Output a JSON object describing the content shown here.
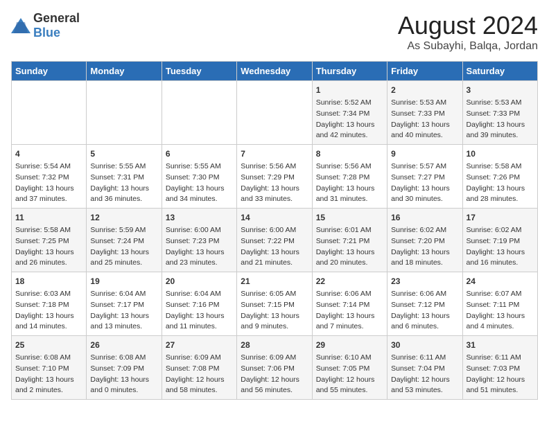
{
  "logo": {
    "general": "General",
    "blue": "Blue"
  },
  "title": "August 2024",
  "subtitle": "As Subayhi, Balqa, Jordan",
  "weekdays": [
    "Sunday",
    "Monday",
    "Tuesday",
    "Wednesday",
    "Thursday",
    "Friday",
    "Saturday"
  ],
  "weeks": [
    [
      {
        "day": "",
        "content": ""
      },
      {
        "day": "",
        "content": ""
      },
      {
        "day": "",
        "content": ""
      },
      {
        "day": "",
        "content": ""
      },
      {
        "day": "1",
        "content": "Sunrise: 5:52 AM\nSunset: 7:34 PM\nDaylight: 13 hours\nand 42 minutes."
      },
      {
        "day": "2",
        "content": "Sunrise: 5:53 AM\nSunset: 7:33 PM\nDaylight: 13 hours\nand 40 minutes."
      },
      {
        "day": "3",
        "content": "Sunrise: 5:53 AM\nSunset: 7:33 PM\nDaylight: 13 hours\nand 39 minutes."
      }
    ],
    [
      {
        "day": "4",
        "content": "Sunrise: 5:54 AM\nSunset: 7:32 PM\nDaylight: 13 hours\nand 37 minutes."
      },
      {
        "day": "5",
        "content": "Sunrise: 5:55 AM\nSunset: 7:31 PM\nDaylight: 13 hours\nand 36 minutes."
      },
      {
        "day": "6",
        "content": "Sunrise: 5:55 AM\nSunset: 7:30 PM\nDaylight: 13 hours\nand 34 minutes."
      },
      {
        "day": "7",
        "content": "Sunrise: 5:56 AM\nSunset: 7:29 PM\nDaylight: 13 hours\nand 33 minutes."
      },
      {
        "day": "8",
        "content": "Sunrise: 5:56 AM\nSunset: 7:28 PM\nDaylight: 13 hours\nand 31 minutes."
      },
      {
        "day": "9",
        "content": "Sunrise: 5:57 AM\nSunset: 7:27 PM\nDaylight: 13 hours\nand 30 minutes."
      },
      {
        "day": "10",
        "content": "Sunrise: 5:58 AM\nSunset: 7:26 PM\nDaylight: 13 hours\nand 28 minutes."
      }
    ],
    [
      {
        "day": "11",
        "content": "Sunrise: 5:58 AM\nSunset: 7:25 PM\nDaylight: 13 hours\nand 26 minutes."
      },
      {
        "day": "12",
        "content": "Sunrise: 5:59 AM\nSunset: 7:24 PM\nDaylight: 13 hours\nand 25 minutes."
      },
      {
        "day": "13",
        "content": "Sunrise: 6:00 AM\nSunset: 7:23 PM\nDaylight: 13 hours\nand 23 minutes."
      },
      {
        "day": "14",
        "content": "Sunrise: 6:00 AM\nSunset: 7:22 PM\nDaylight: 13 hours\nand 21 minutes."
      },
      {
        "day": "15",
        "content": "Sunrise: 6:01 AM\nSunset: 7:21 PM\nDaylight: 13 hours\nand 20 minutes."
      },
      {
        "day": "16",
        "content": "Sunrise: 6:02 AM\nSunset: 7:20 PM\nDaylight: 13 hours\nand 18 minutes."
      },
      {
        "day": "17",
        "content": "Sunrise: 6:02 AM\nSunset: 7:19 PM\nDaylight: 13 hours\nand 16 minutes."
      }
    ],
    [
      {
        "day": "18",
        "content": "Sunrise: 6:03 AM\nSunset: 7:18 PM\nDaylight: 13 hours\nand 14 minutes."
      },
      {
        "day": "19",
        "content": "Sunrise: 6:04 AM\nSunset: 7:17 PM\nDaylight: 13 hours\nand 13 minutes."
      },
      {
        "day": "20",
        "content": "Sunrise: 6:04 AM\nSunset: 7:16 PM\nDaylight: 13 hours\nand 11 minutes."
      },
      {
        "day": "21",
        "content": "Sunrise: 6:05 AM\nSunset: 7:15 PM\nDaylight: 13 hours\nand 9 minutes."
      },
      {
        "day": "22",
        "content": "Sunrise: 6:06 AM\nSunset: 7:14 PM\nDaylight: 13 hours\nand 7 minutes."
      },
      {
        "day": "23",
        "content": "Sunrise: 6:06 AM\nSunset: 7:12 PM\nDaylight: 13 hours\nand 6 minutes."
      },
      {
        "day": "24",
        "content": "Sunrise: 6:07 AM\nSunset: 7:11 PM\nDaylight: 13 hours\nand 4 minutes."
      }
    ],
    [
      {
        "day": "25",
        "content": "Sunrise: 6:08 AM\nSunset: 7:10 PM\nDaylight: 13 hours\nand 2 minutes."
      },
      {
        "day": "26",
        "content": "Sunrise: 6:08 AM\nSunset: 7:09 PM\nDaylight: 13 hours\nand 0 minutes."
      },
      {
        "day": "27",
        "content": "Sunrise: 6:09 AM\nSunset: 7:08 PM\nDaylight: 12 hours\nand 58 minutes."
      },
      {
        "day": "28",
        "content": "Sunrise: 6:09 AM\nSunset: 7:06 PM\nDaylight: 12 hours\nand 56 minutes."
      },
      {
        "day": "29",
        "content": "Sunrise: 6:10 AM\nSunset: 7:05 PM\nDaylight: 12 hours\nand 55 minutes."
      },
      {
        "day": "30",
        "content": "Sunrise: 6:11 AM\nSunset: 7:04 PM\nDaylight: 12 hours\nand 53 minutes."
      },
      {
        "day": "31",
        "content": "Sunrise: 6:11 AM\nSunset: 7:03 PM\nDaylight: 12 hours\nand 51 minutes."
      }
    ]
  ]
}
